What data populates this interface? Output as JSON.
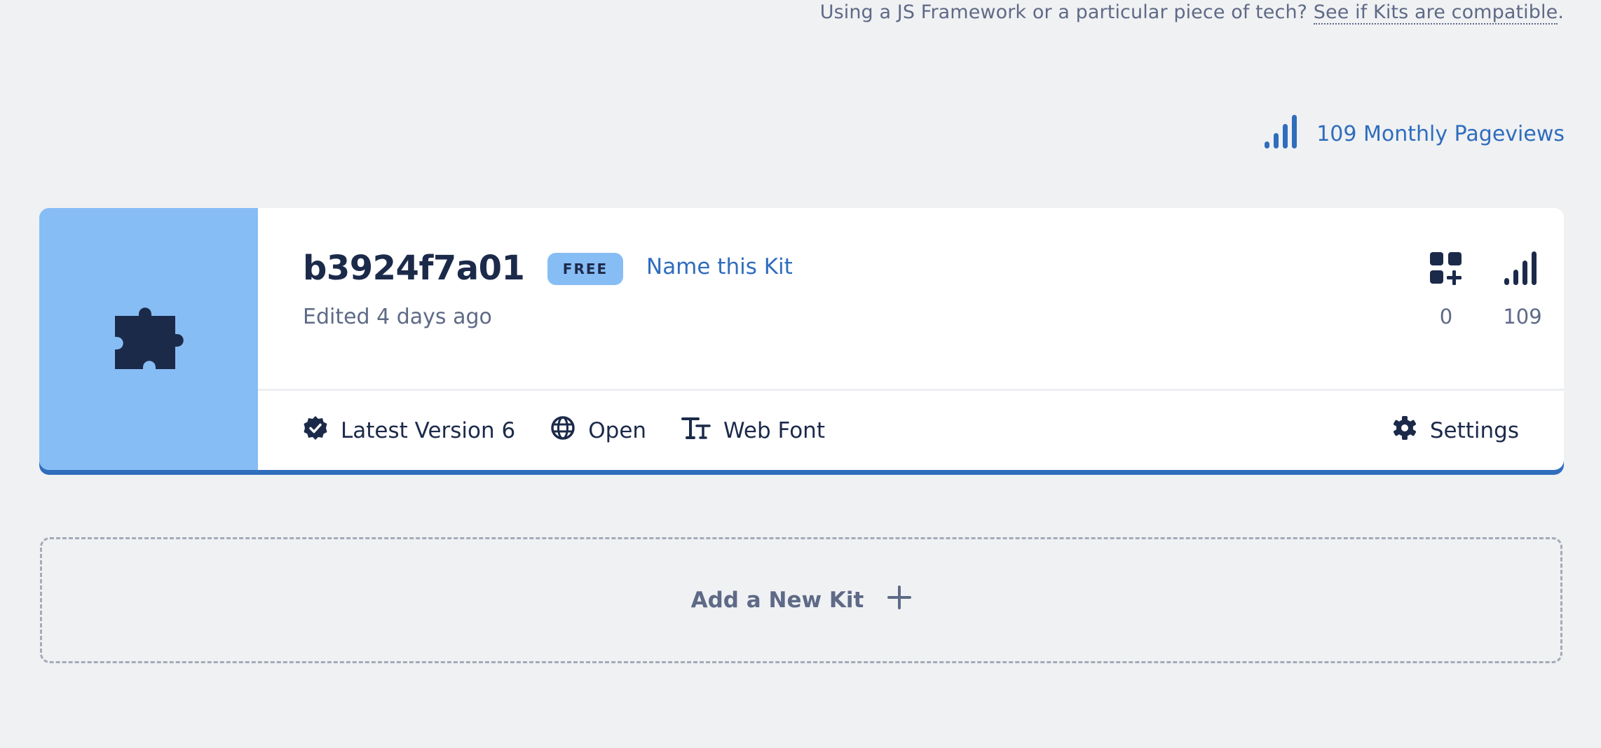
{
  "colors": {
    "background": "#f0f1f3",
    "accent": "#2f6dbd",
    "kit_thumb": "#87bdf5",
    "text_dark": "#1c2a4a",
    "text_muted": "#5e6a86"
  },
  "compat": {
    "text": "Using a JS Framework or a particular piece of tech? ",
    "link": "See if Kits are compatible",
    "end": "."
  },
  "summary": {
    "pageviews_label": "109 Monthly Pageviews",
    "icon": "signal-bars-icon"
  },
  "kit": {
    "name": "b3924f7a01",
    "plan_badge": "FREE",
    "name_link": "Name this Kit",
    "edited": "Edited 4 days ago",
    "thumb_icon": "puzzle-piece-icon",
    "stats": [
      {
        "icon": "custom-icons-icon",
        "value": "0"
      },
      {
        "icon": "signal-bars-icon",
        "value": "109"
      }
    ],
    "meta": {
      "version": "Latest Version 6",
      "visibility": "Open",
      "tech": "Web Font",
      "settings": "Settings"
    }
  },
  "add_kit": {
    "label": "Add a New Kit",
    "icon": "plus-icon"
  }
}
